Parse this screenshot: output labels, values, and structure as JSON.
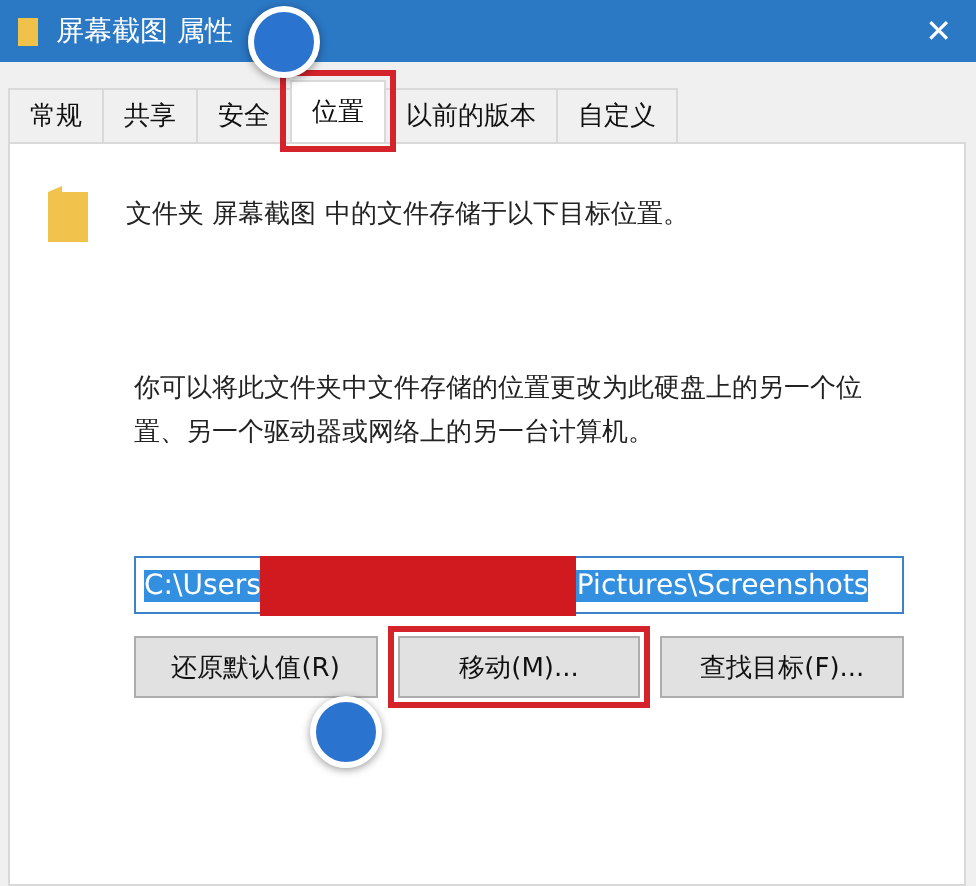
{
  "window": {
    "title": "屏幕截图 属性",
    "close": "✕"
  },
  "tabs": [
    {
      "label": "常规",
      "selected": false,
      "highlighted": false
    },
    {
      "label": "共享",
      "selected": false,
      "highlighted": false
    },
    {
      "label": "安全",
      "selected": false,
      "highlighted": false
    },
    {
      "label": "位置",
      "selected": true,
      "highlighted": true
    },
    {
      "label": "以前的版本",
      "selected": false,
      "highlighted": false
    },
    {
      "label": "自定义",
      "selected": false,
      "highlighted": false
    }
  ],
  "intro": "文件夹 屏幕截图 中的文件存储于以下目标位置。",
  "description": "你可以将此文件夹中文件存储的位置更改为此硬盘上的另一个位置、另一个驱动器或网络上的另一台计算机。",
  "path_field": {
    "text_start": "C:\\Users",
    "text_end": "Pictures\\Screenshots",
    "selected": true
  },
  "buttons": [
    {
      "label": "还原默认值(R)",
      "highlighted": false
    },
    {
      "label": "移动(M)...",
      "highlighted": true
    },
    {
      "label": "查找目标(F)...",
      "highlighted": false
    }
  ]
}
